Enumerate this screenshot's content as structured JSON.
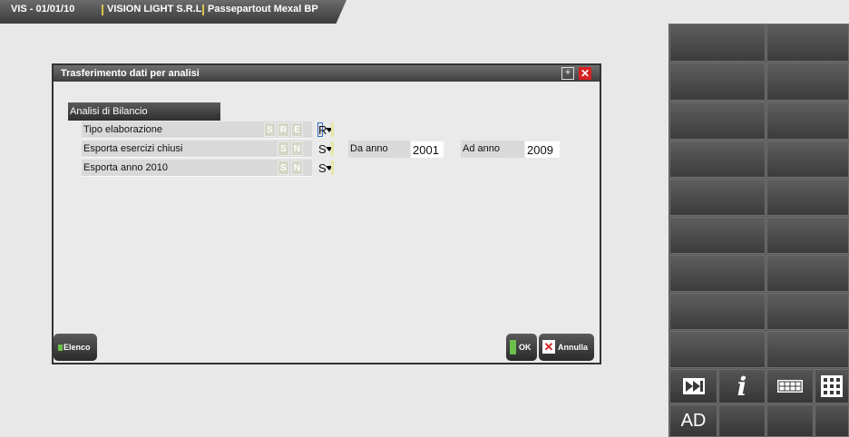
{
  "topbar": {
    "segment1": "VIS - 01/01/10",
    "segment2": "VISION LIGHT S.R.L.",
    "segment3": "Passepartout Mexal BP"
  },
  "dialog": {
    "title": "Trasferimento dati per analisi",
    "section_label": "Analisi di Bilancio",
    "rows": [
      {
        "label": "Tipo elaborazione",
        "options": [
          "S",
          "R",
          "E"
        ],
        "value": "R"
      },
      {
        "label": "Esporta esercizi chiusi",
        "options": [
          "S",
          "N"
        ],
        "value": "S"
      },
      {
        "label": "Esporta anno 2010",
        "options": [
          "S",
          "N"
        ],
        "value": "S"
      }
    ],
    "da_anno": {
      "label": "Da anno",
      "value": "2001"
    },
    "ad_anno": {
      "label": "Ad anno",
      "value": "2009"
    },
    "buttons": {
      "elenco": "Elenco",
      "ok": "OK",
      "annulla": "Annulla"
    }
  },
  "right_panel": {
    "ad_label": "AD",
    "icons": [
      "fast-forward-icon",
      "info-icon",
      "keyboard-icon",
      "grid-icon"
    ]
  },
  "colors": {
    "accent_green": "#6cc04a",
    "close_red": "#d72020",
    "chip_yellow": "#e7e7a5"
  }
}
